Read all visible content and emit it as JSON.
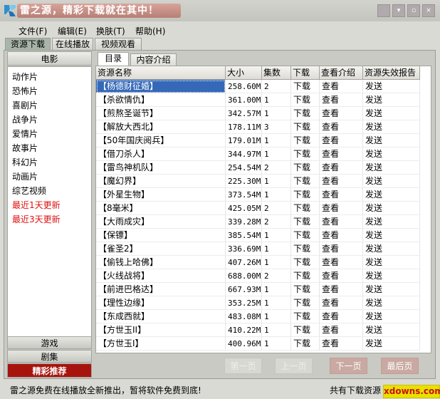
{
  "window": {
    "title": "雷之源，精彩下载就在其中！",
    "controls": [
      "menu-icon",
      "download-icon",
      "restore-icon",
      "close-icon"
    ]
  },
  "menu": [
    "文件(F)",
    "编辑(E)",
    "换肤(T)",
    "帮助(H)"
  ],
  "top_tabs": [
    "资源下载",
    "在线播放",
    "视频观看"
  ],
  "sidebar": {
    "header": "电影",
    "items": [
      "动作片",
      "恐怖片",
      "喜剧片",
      "战争片",
      "爱情片",
      "故事片",
      "科幻片",
      "动画片",
      "综艺视频"
    ],
    "red_items": [
      "最近1天更新",
      "最近3天更新"
    ],
    "bottom_buttons": [
      "游戏",
      "剧集",
      "精彩推荐"
    ]
  },
  "content_tabs": [
    "目录",
    "内容介绍"
  ],
  "table": {
    "headers": [
      "资源名称",
      "大小",
      "集数",
      "下载",
      "查看介绍",
      "资源失效报告"
    ],
    "rows": [
      {
        "name": "【杨德财征婚】",
        "size": "258.60M",
        "eps": "2",
        "dl": "下载",
        "view": "查看",
        "report": "发送"
      },
      {
        "name": "【杀欲情仇】",
        "size": "361.00M",
        "eps": "1",
        "dl": "下载",
        "view": "查看",
        "report": "发送"
      },
      {
        "name": "【煎熬圣诞节】",
        "size": "342.57M",
        "eps": "1",
        "dl": "下载",
        "view": "查看",
        "report": "发送"
      },
      {
        "name": "【解放大西北】",
        "size": "178.11M",
        "eps": "3",
        "dl": "下载",
        "view": "查看",
        "report": "发送"
      },
      {
        "name": "【50年国庆阅兵】",
        "size": "179.01M",
        "eps": "1",
        "dl": "下载",
        "view": "查看",
        "report": "发送"
      },
      {
        "name": "【借刀杀人】",
        "size": "344.97M",
        "eps": "1",
        "dl": "下载",
        "view": "查看",
        "report": "发送"
      },
      {
        "name": "【雷鸟神机队】",
        "size": "254.54M",
        "eps": "2",
        "dl": "下载",
        "view": "查看",
        "report": "发送"
      },
      {
        "name": "【魔幻界】",
        "size": "225.30M",
        "eps": "1",
        "dl": "下载",
        "view": "查看",
        "report": "发送"
      },
      {
        "name": "【外星生物】",
        "size": "373.54M",
        "eps": "1",
        "dl": "下载",
        "view": "查看",
        "report": "发送"
      },
      {
        "name": "【8毫米】",
        "size": "425.05M",
        "eps": "2",
        "dl": "下载",
        "view": "查看",
        "report": "发送"
      },
      {
        "name": "【大雨成灾】",
        "size": "339.28M",
        "eps": "2",
        "dl": "下载",
        "view": "查看",
        "report": "发送"
      },
      {
        "name": "【保镖】",
        "size": "385.54M",
        "eps": "1",
        "dl": "下载",
        "view": "查看",
        "report": "发送"
      },
      {
        "name": "【雀圣2】",
        "size": "336.69M",
        "eps": "1",
        "dl": "下载",
        "view": "查看",
        "report": "发送"
      },
      {
        "name": "【偷钱上哈佛】",
        "size": "407.26M",
        "eps": "1",
        "dl": "下载",
        "view": "查看",
        "report": "发送"
      },
      {
        "name": "【火线战将】",
        "size": "688.00M",
        "eps": "2",
        "dl": "下载",
        "view": "查看",
        "report": "发送"
      },
      {
        "name": "【前进巴格达】",
        "size": "667.93M",
        "eps": "1",
        "dl": "下载",
        "view": "查看",
        "report": "发送"
      },
      {
        "name": "【理性边缘】",
        "size": "353.25M",
        "eps": "1",
        "dl": "下载",
        "view": "查看",
        "report": "发送"
      },
      {
        "name": "【东成西就】",
        "size": "483.08M",
        "eps": "1",
        "dl": "下载",
        "view": "查看",
        "report": "发送"
      },
      {
        "name": "【方世玉II】",
        "size": "410.22M",
        "eps": "1",
        "dl": "下载",
        "view": "查看",
        "report": "发送"
      },
      {
        "name": "【方世玉I】",
        "size": "400.96M",
        "eps": "1",
        "dl": "下载",
        "view": "查看",
        "report": "发送"
      }
    ]
  },
  "pager": [
    "第一页",
    "上一页",
    "下一页",
    "最后页"
  ],
  "status": {
    "left": "雷之源免费在线播放全新推出，暂将软件免费到底!",
    "right": "共有下载资源",
    "watermark": "xdowns.com"
  }
}
